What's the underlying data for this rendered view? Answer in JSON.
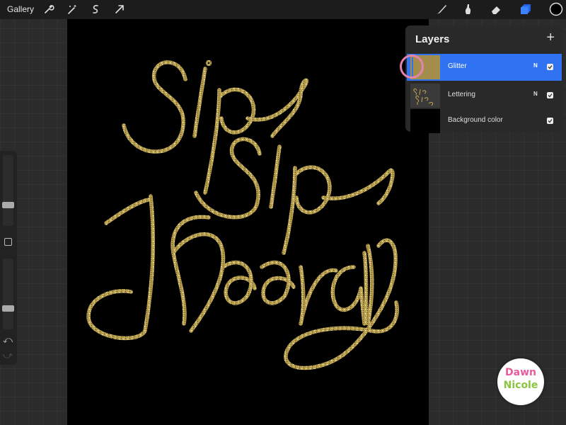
{
  "toolbar": {
    "gallery_label": "Gallery",
    "left_tools": [
      "wrench-icon",
      "magic-wand-icon",
      "selection-icon",
      "transform-arrow-icon"
    ],
    "right_tools": [
      "brush-icon",
      "smudge-icon",
      "eraser-icon",
      "layers-icon",
      "color-swatch"
    ],
    "current_color": "#000000"
  },
  "canvas": {
    "background": "#000000",
    "lettering_color": "#c9b56a"
  },
  "layers_panel": {
    "title": "Layers",
    "add_icon": "+",
    "layers": [
      {
        "name": "Glitter",
        "mode": "N",
        "visible": true,
        "selected": true
      },
      {
        "name": "Lettering",
        "mode": "N",
        "visible": true,
        "selected": false
      },
      {
        "name": "Background color",
        "mode": "",
        "visible": true,
        "selected": false
      }
    ]
  },
  "sidebar": {
    "brush_size": 0.3,
    "opacity": 0.3,
    "undo_icon": "⤺",
    "redo_icon": "⤻"
  },
  "watermark": {
    "line1": "Dawn",
    "line2": "Nicole"
  }
}
